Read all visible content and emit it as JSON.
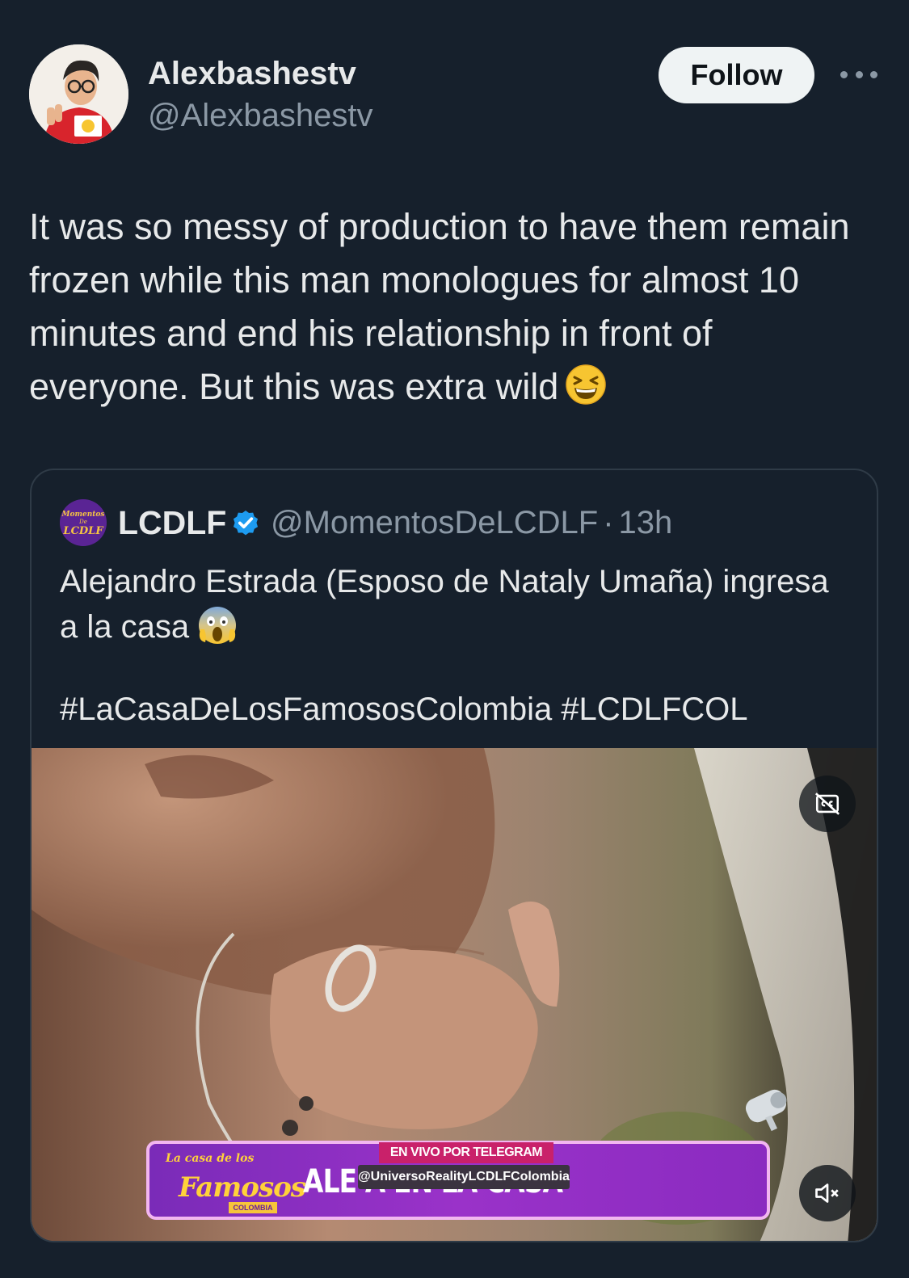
{
  "author": {
    "name": "Alexbashestv",
    "handle": "@Alexbashestv",
    "avatar_icon": "profile-photo"
  },
  "actions": {
    "follow_label": "Follow",
    "more_icon": "more-horizontal-icon"
  },
  "tweet": {
    "text": "It was so messy of production to have them remain frozen while this man monologues for almost 10 minutes and end his relationship in front of everyone. But this was extra wild",
    "emoji": "grinning-squinting-face"
  },
  "quote": {
    "name": "LCDLF",
    "verified": true,
    "handle": "@MomentosDeLCDLF",
    "separator": "·",
    "time": "13h",
    "text": "Alejandro Estrada (Esposo de Nataly Umaña) ingresa a la casa",
    "emoji": "face-screaming-in-fear",
    "hashtags": "#LaCasaDeLosFamososColombia #LCDLFCOL",
    "avatar_text": {
      "top": "Momentos",
      "mid": "De",
      "bottom": "LCDLF"
    }
  },
  "video": {
    "cc_icon": "captions-off-icon",
    "mute_icon": "volume-muted-icon",
    "banner": {
      "logo_top": "La casa de los",
      "logo_main": "Famosos",
      "logo_sub": "COLOMBIA",
      "headline": "ALE                    A EN LA CASA",
      "live_label": "EN VIVO POR TELEGRAM",
      "telegram_handle": "@UniversoRealityLCDLFColombia"
    }
  },
  "colors": {
    "background": "#16202c",
    "text_primary": "#e7e9ea",
    "text_secondary": "#8b98a5",
    "verified_blue": "#1d9bf0",
    "follow_bg": "#eff3f4"
  }
}
